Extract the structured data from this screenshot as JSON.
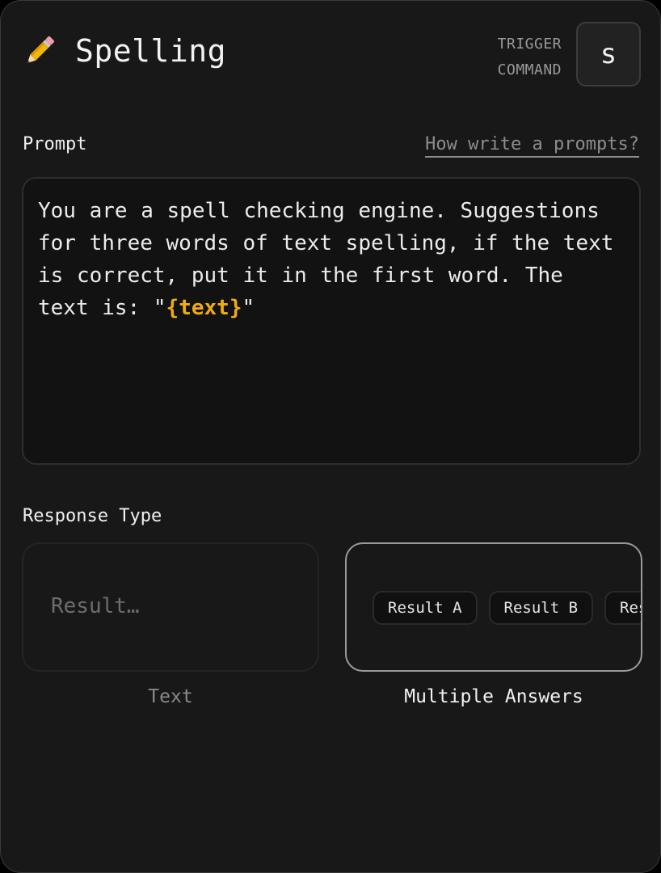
{
  "header": {
    "icon": "pencil-icon",
    "title": "Spelling",
    "trigger_label_line1": "TRIGGER",
    "trigger_label_line2": "COMMAND",
    "trigger_key": "s"
  },
  "prompt": {
    "label": "Prompt",
    "help_link": "How write a prompts?",
    "text_before": "You are a spell checking engine. Suggestions for three words of text spelling, if the text is correct, put it in the first word. The text is: \"",
    "variable": "{text}",
    "text_after": "\""
  },
  "response_type": {
    "label": "Response Type",
    "options": [
      {
        "caption": "Text",
        "placeholder": "Result…",
        "selected": false
      },
      {
        "caption": "Multiple Answers",
        "chips": [
          "Result A",
          "Result B",
          "Result C"
        ],
        "selected": true
      }
    ]
  },
  "colors": {
    "background": "#181818",
    "accent_variable": "#f0ab10",
    "selected_border": "#9a9a9a"
  }
}
